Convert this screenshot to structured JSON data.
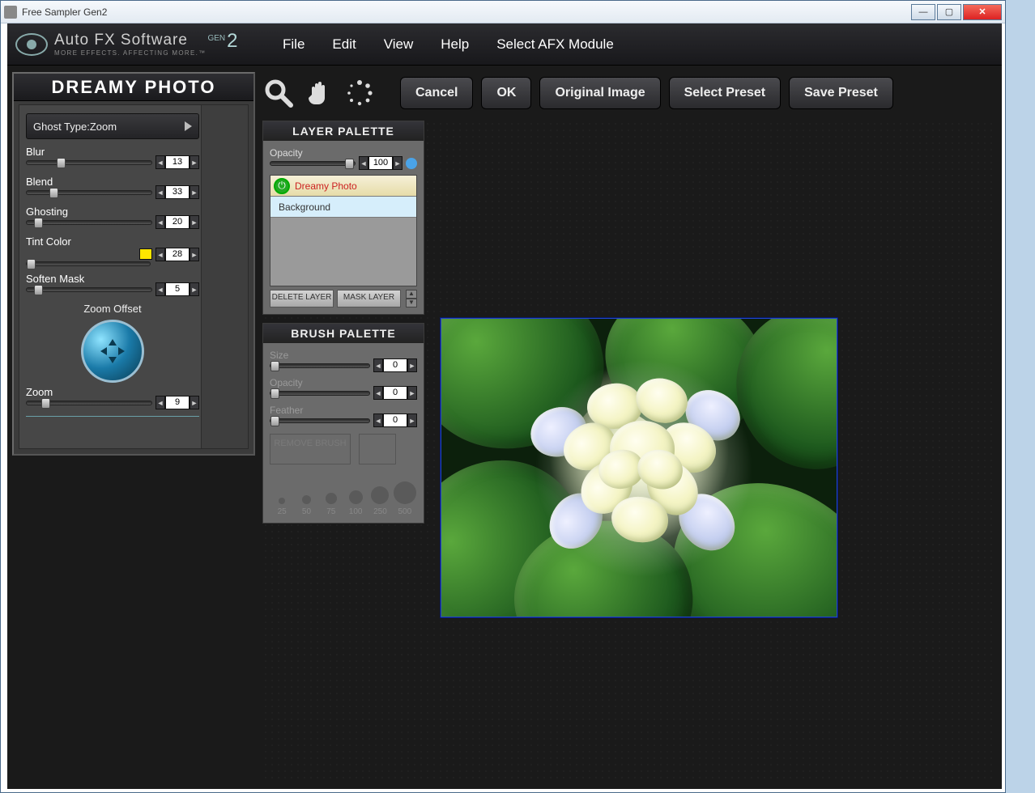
{
  "window": {
    "title": "Free Sampler Gen2"
  },
  "brand": {
    "line1": "Auto FX Software",
    "line2": "MORE EFFECTS. AFFECTING MORE.™",
    "gen": "GEN",
    "gen_num": "2"
  },
  "menu": {
    "file": "File",
    "edit": "Edit",
    "view": "View",
    "help": "Help",
    "select_module": "Select AFX Module"
  },
  "buttons": {
    "cancel": "Cancel",
    "ok": "OK",
    "original": "Original Image",
    "select_preset": "Select Preset",
    "save_preset": "Save Preset"
  },
  "left_panel": {
    "title": "DREAMY PHOTO",
    "ghost_type_label": "Ghost Type:",
    "ghost_type_value": "Zoom",
    "sliders": {
      "blur": {
        "label": "Blur",
        "value": "13",
        "pos": 24
      },
      "blend": {
        "label": "Blend",
        "value": "33",
        "pos": 18
      },
      "ghost": {
        "label": "Ghosting",
        "value": "20",
        "pos": 6
      },
      "tint": {
        "label": "Tint Color",
        "value": "28",
        "pos": 0,
        "swatch": "#ffe600"
      },
      "soften": {
        "label": "Soften Mask",
        "value": "5",
        "pos": 6
      },
      "zoom": {
        "label": "Zoom",
        "value": "9",
        "pos": 12
      }
    },
    "zoom_offset_label": "Zoom Offset"
  },
  "layer_palette": {
    "title": "LAYER PALETTE",
    "opacity_label": "Opacity",
    "opacity_value": "100",
    "layers": {
      "active": "Dreamy Photo",
      "bg": "Background"
    },
    "delete": "DELETE LAYER",
    "mask": "MASK LAYER"
  },
  "brush_palette": {
    "title": "BRUSH PALETTE",
    "size_label": "Size",
    "size_value": "0",
    "opacity_label": "Opacity",
    "opacity_value": "0",
    "feather_label": "Feather",
    "feather_value": "0",
    "remove": "REMOVE BRUSH",
    "sizes": [
      "25",
      "50",
      "75",
      "100",
      "250",
      "500"
    ]
  }
}
